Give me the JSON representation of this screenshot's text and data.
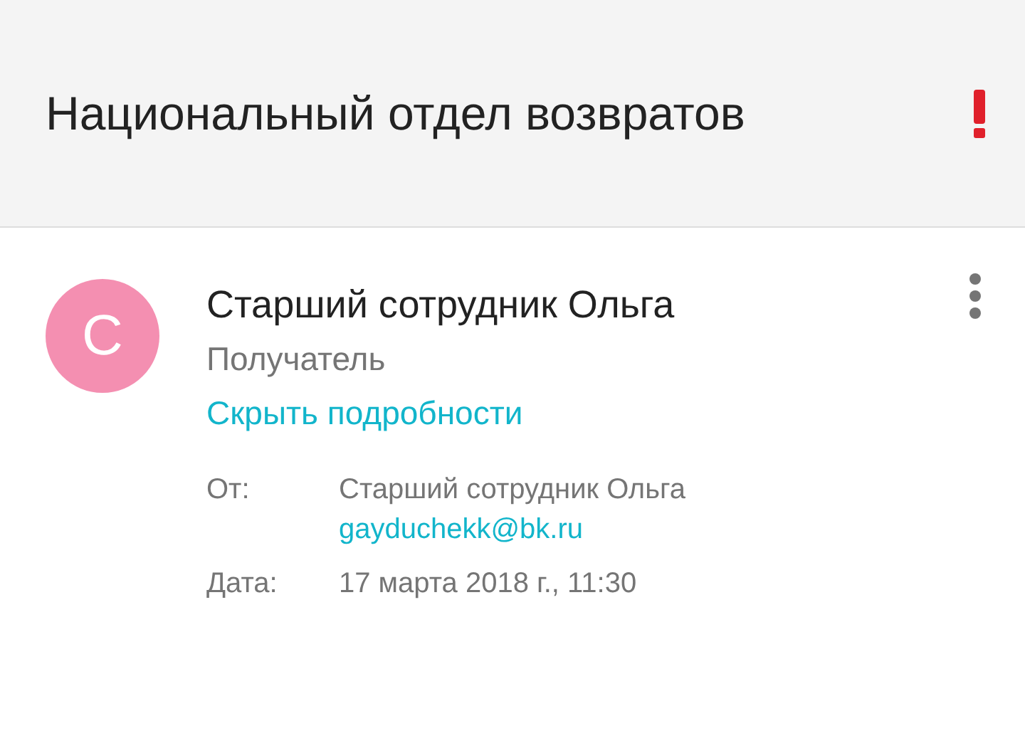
{
  "header": {
    "subject": "Национальный отдел возвратов",
    "important": true
  },
  "message": {
    "avatar_letter": "С",
    "sender": "Старший сотрудник Ольга",
    "recipient": "Получатель",
    "details_link": "Скрыть подробности",
    "details": [
      {
        "label": "От:",
        "lines": [
          {
            "text": "Старший сотрудник Ольга",
            "kind": "text"
          },
          {
            "text": "gayduchekk@bk.ru",
            "kind": "link"
          }
        ]
      },
      {
        "label": "Дата:",
        "lines": [
          {
            "text": "17 марта 2018 г., 11:30",
            "kind": "text"
          }
        ]
      }
    ]
  }
}
